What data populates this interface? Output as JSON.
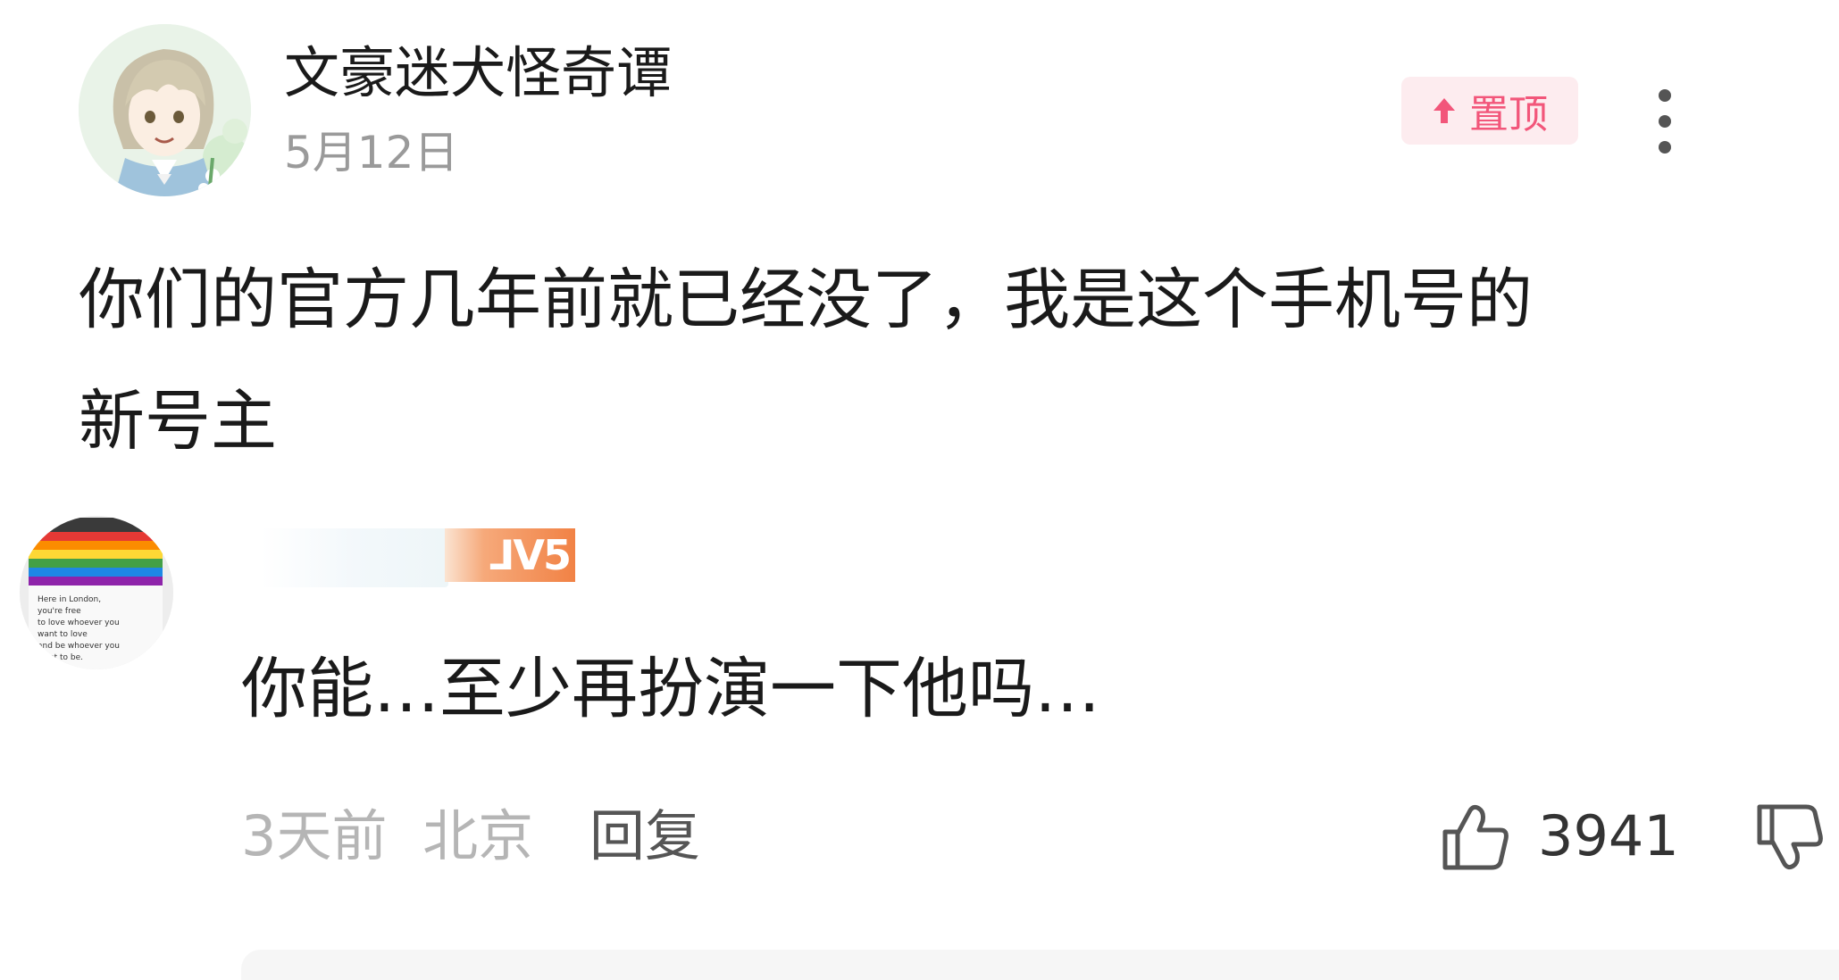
{
  "post": {
    "author": "文豪迷犬怪奇谭",
    "date": "5月12日",
    "pin_label": "置顶",
    "body": "你们的官方几年前就已经没了，我是这个手机号的\n新号主"
  },
  "reply": {
    "level_badge": "ᒧV5",
    "text": "你能…至少再扮演一下他吗…",
    "time": "3天前",
    "location": "北京",
    "reply_label": "回复",
    "like_count": "3941",
    "avatar_text": "Here in London,\nyou're free\nto love whoever you\nwant to love\nand be whoever you\nwant to be."
  },
  "icons": {
    "pin": "arrow-up-icon",
    "more": "more-vertical-icon",
    "like": "thumb-up-icon",
    "dislike": "thumb-down-icon"
  },
  "colors": {
    "pin_text": "#f2567a",
    "pin_bg": "#fdecef",
    "level_badge": "#f18245",
    "meta_text": "#b5b5b5"
  }
}
